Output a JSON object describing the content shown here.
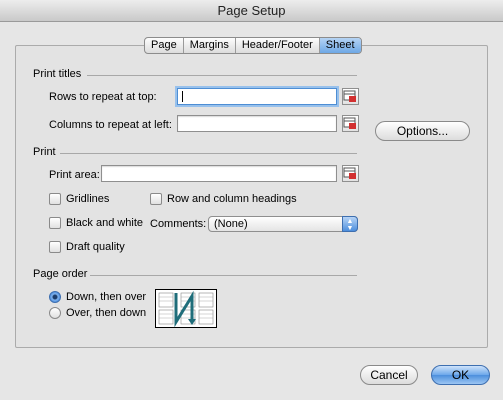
{
  "window": {
    "title": "Page Setup"
  },
  "tabs": [
    {
      "label": "Page"
    },
    {
      "label": "Margins"
    },
    {
      "label": "Header/Footer"
    },
    {
      "label": "Sheet",
      "active": true
    }
  ],
  "print_titles": {
    "heading": "Print titles",
    "rows_label": "Rows to repeat at top:",
    "rows_value": "",
    "columns_label": "Columns to repeat at left:",
    "columns_value": ""
  },
  "options_button": "Options...",
  "print": {
    "heading": "Print",
    "area_label": "Print area:",
    "area_value": "",
    "gridlines_label": "Gridlines",
    "black_white_label": "Black and white",
    "draft_label": "Draft quality",
    "row_col_headings_label": "Row and column headings",
    "comments_label": "Comments:",
    "comments_value": "(None)"
  },
  "page_order": {
    "heading": "Page order",
    "down_then_over": "Down, then over",
    "over_then_down": "Over, then down",
    "selected": "down_then_over"
  },
  "buttons": {
    "cancel": "Cancel",
    "ok": "OK"
  },
  "colors": {
    "accent": "#4c8fdd",
    "dialog_bg": "#e6e6e6",
    "panel_bg": "#e3e3e3"
  },
  "icons": {
    "collapse_dialog": "range-select-icon",
    "page_order": "page-order-diagram-icon"
  }
}
